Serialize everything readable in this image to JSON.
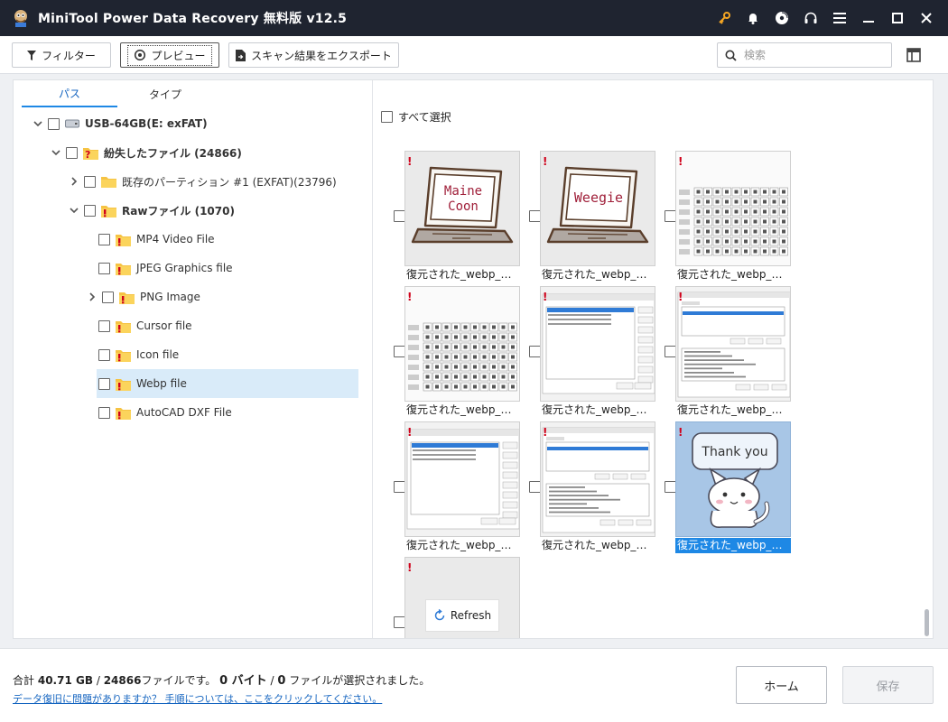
{
  "window": {
    "title": "MiniTool Power Data Recovery 無料版 v12.5",
    "icons": [
      "key-icon",
      "bell-icon",
      "disc-icon",
      "headset-icon",
      "menu-icon",
      "minimize-icon",
      "maximize-icon",
      "close-icon"
    ]
  },
  "toolbar": {
    "filter_label": "フィルター",
    "preview_label": "プレビュー",
    "export_label": "スキャン結果をエクスポート",
    "search_placeholder": "検索"
  },
  "tabs": [
    {
      "label": "パス",
      "selected": true
    },
    {
      "label": "タイプ",
      "selected": false
    }
  ],
  "tree": [
    {
      "label": "USB-64GB(E: exFAT)",
      "bold": true,
      "expanded": true,
      "icon": "drive-icon"
    },
    {
      "label": "紛失したファイル (24866)",
      "bold": true,
      "expanded": true,
      "icon": "lost-folder-icon"
    },
    {
      "label": "既存のパーティション #1 (EXFAT)(23796)",
      "bold": false,
      "expanded": false,
      "icon": "folder-icon"
    },
    {
      "label": "Rawファイル (1070)",
      "bold": true,
      "expanded": true,
      "icon": "raw-folder-icon"
    },
    {
      "label": "MP4 Video File",
      "bold": false,
      "icon": "raw-folder-icon"
    },
    {
      "label": "JPEG Graphics file",
      "bold": false,
      "icon": "raw-folder-icon"
    },
    {
      "label": "PNG Image",
      "bold": false,
      "expanded": false,
      "icon": "raw-folder-icon"
    },
    {
      "label": "Cursor file",
      "bold": false,
      "icon": "raw-folder-icon"
    },
    {
      "label": "Icon file",
      "bold": false,
      "icon": "raw-folder-icon"
    },
    {
      "label": "Webp file",
      "bold": false,
      "selected": true,
      "icon": "raw-folder-icon"
    },
    {
      "label": "AutoCAD DXF File",
      "bold": false,
      "icon": "raw-folder-icon"
    }
  ],
  "select_all_label": "すべて選択",
  "thumbnails": [
    {
      "label": "復元された_webp_ファイル",
      "kind": "laptop",
      "text": [
        "Maine",
        "Coon"
      ]
    },
    {
      "label": "復元された_webp_ファイル",
      "kind": "laptop",
      "text": [
        "Weegie"
      ]
    },
    {
      "label": "復元された_webp_ファイル",
      "kind": "charmap"
    },
    {
      "label": "復元された_webp_ファイル",
      "kind": "charmap"
    },
    {
      "label": "復元された_webp_ファイル",
      "kind": "dialog"
    },
    {
      "label": "復元された_webp_ファイル",
      "kind": "dialog2"
    },
    {
      "label": "復元された_webp_ファイル",
      "kind": "dialog"
    },
    {
      "label": "復元された_webp_ファイル",
      "kind": "dialog2"
    },
    {
      "label": "復元された_webp_ファイル",
      "kind": "cat",
      "text": [
        "Thank you"
      ],
      "selected": true
    },
    {
      "label": "",
      "kind": "refresh",
      "text": [
        "Refresh"
      ]
    }
  ],
  "status": {
    "prefix": "合計",
    "total_size": "40.71 GB",
    "separator": "/",
    "file_count": "24866",
    "mid": "ファイルです。",
    "sel_bytes": "0 バイト",
    "sel_sep": "/",
    "sel_files": "0",
    "suffix": "ファイルが選択されました。"
  },
  "help_link": "データ復旧に問題がありますか？ 手順については、ここをクリックしてください。",
  "buttons": {
    "home": "ホーム",
    "save": "保存"
  },
  "colors": {
    "titlebar": "#1f2430",
    "accent": "#1e88e5",
    "error_mark": "#d0021b",
    "key_icon": "#f5a623"
  }
}
